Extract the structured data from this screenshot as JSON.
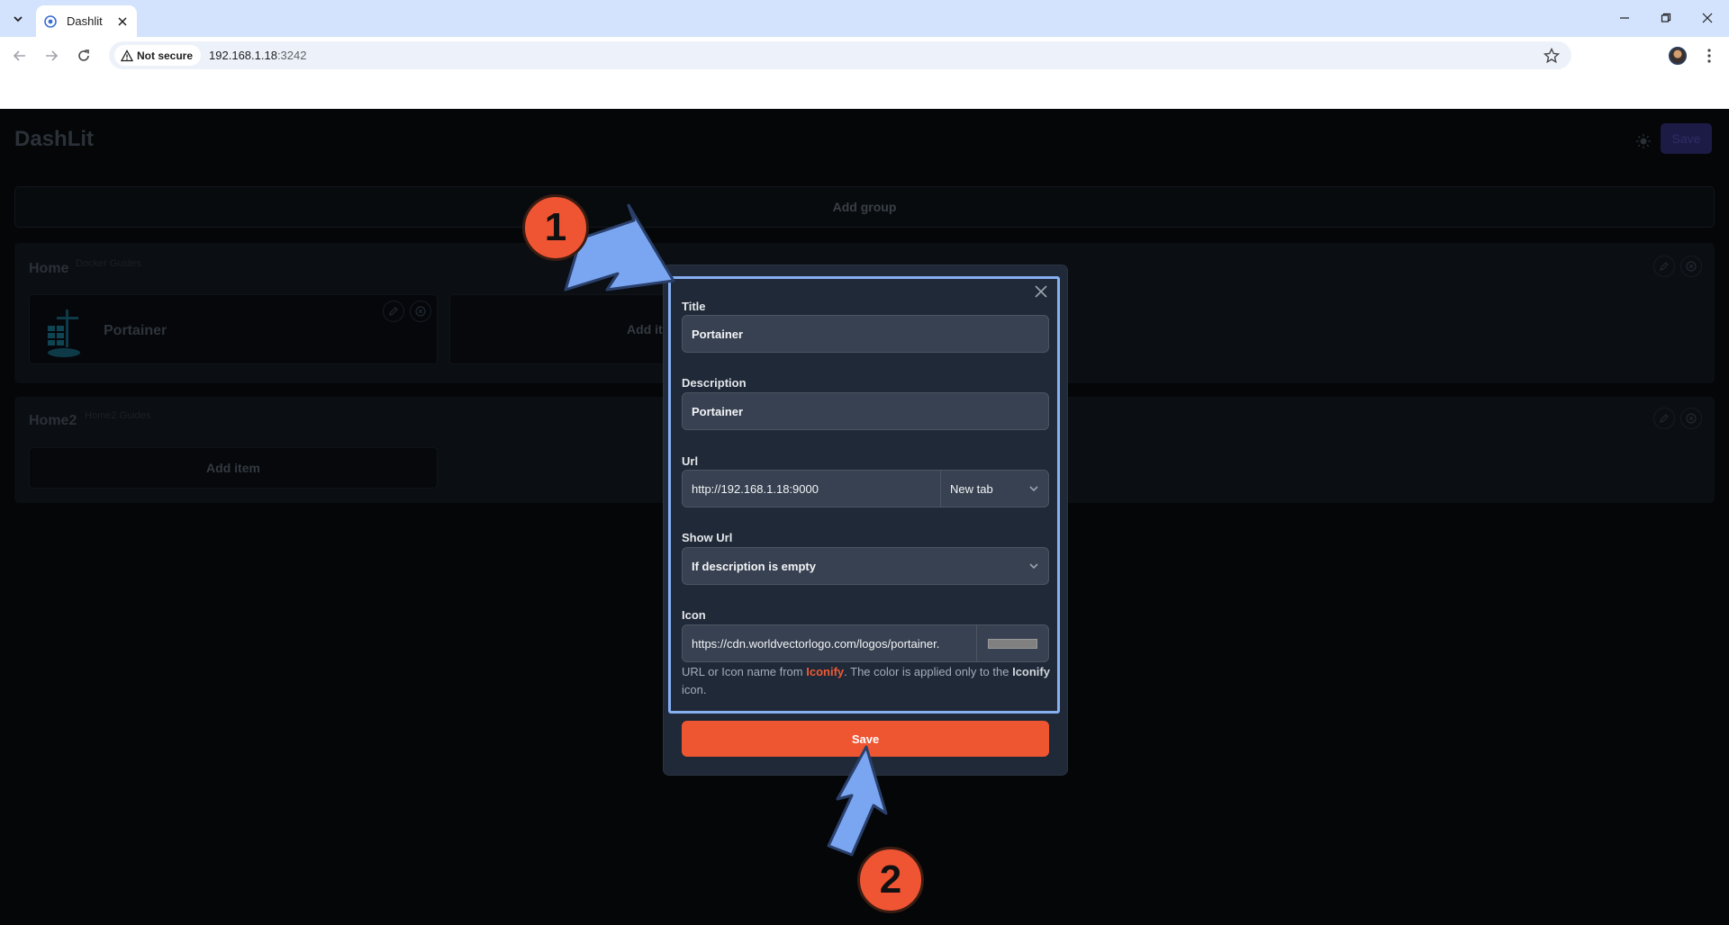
{
  "browser": {
    "tab_title": "Dashlit",
    "security_chip": "Not secure",
    "url_host": "192.168.1.18",
    "url_port": ":3242"
  },
  "app": {
    "title": "DashLit",
    "save_label": "Save",
    "add_group_label": "Add group"
  },
  "groups": [
    {
      "name": "Home",
      "description": "Docker Guides",
      "items": [
        {
          "title": "Portainer"
        }
      ],
      "add_item_label": "Add item"
    },
    {
      "name": "Home2",
      "description": "Home2 Guides",
      "add_item_label": "Add item"
    }
  ],
  "modal": {
    "title_label": "Title",
    "title_value": "Portainer",
    "description_label": "Description",
    "description_value": "Portainer",
    "url_label": "Url",
    "url_value": "http://192.168.1.18:9000",
    "url_target": "New tab",
    "show_url_label": "Show Url",
    "show_url_value": "If description is empty",
    "icon_label": "Icon",
    "icon_value": "https://cdn.worldvectorlogo.com/logos/portainer.",
    "icon_color": "#808080",
    "help_prefix": "URL or Icon name from ",
    "help_link": "Iconify",
    "help_middle": ". The color is applied only to the ",
    "help_strong": "Iconify",
    "help_suffix": " icon.",
    "save_label": "Save"
  },
  "annotations": {
    "step1": "1",
    "step2": "2"
  },
  "colors": {
    "accent": "#ee5531",
    "highlight": "#87b0f3",
    "modal_bg": "#1f2937"
  }
}
